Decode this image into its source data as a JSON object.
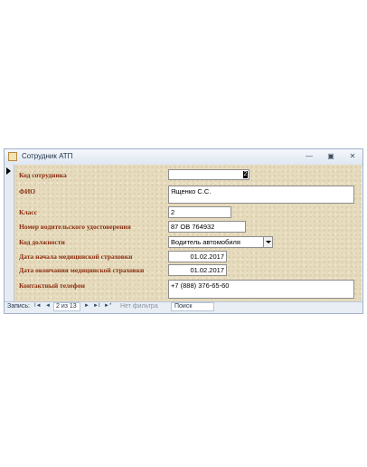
{
  "window": {
    "title": "Сотрудник АТП",
    "minimize": "—",
    "restore": "▣",
    "close": "✕"
  },
  "form": {
    "fields": [
      {
        "label": "Код сотрудника",
        "value": "2"
      },
      {
        "label": "ФИО",
        "value": "Ященко С.С."
      },
      {
        "label": "Класс",
        "value": "2"
      },
      {
        "label": "Номер водительского удостоверения",
        "value": "87 ОВ 764932"
      },
      {
        "label": "Код должности",
        "value": "Водитель автомобиля"
      },
      {
        "label": "Дата начала медицинской страховки",
        "value": "01.02.2017"
      },
      {
        "label": "Дата окончания медицинской страховки",
        "value": "01.02.2017"
      },
      {
        "label": "Контактный телефон",
        "value": "+7 (888) 376-65-60"
      }
    ]
  },
  "navigator": {
    "label": "Запись:",
    "first": "I◄",
    "prev": "◄",
    "position": "2 из 13",
    "next": "►",
    "last": "►I",
    "new": "►*",
    "filter": "Нет фильтра",
    "search": "Поиск"
  }
}
